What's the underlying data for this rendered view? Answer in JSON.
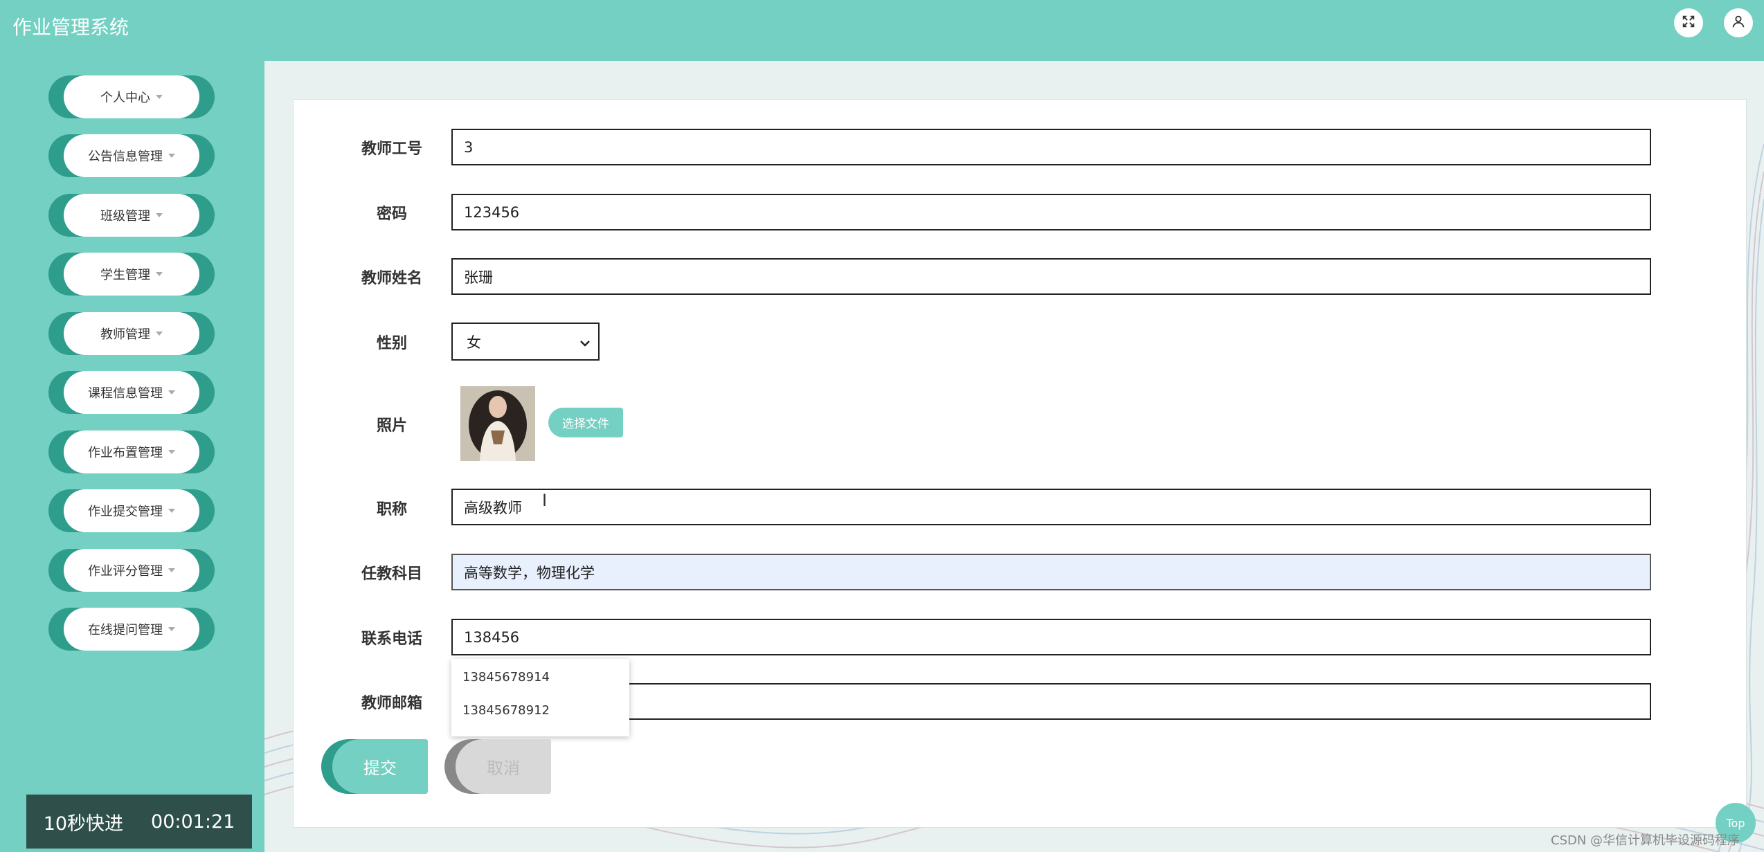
{
  "header": {
    "title": "作业管理系统",
    "fullscreen_icon": "expand-icon",
    "user_icon": "user-icon"
  },
  "sidebar": {
    "items": [
      {
        "label": "个人中心"
      },
      {
        "label": "公告信息管理"
      },
      {
        "label": "班级管理"
      },
      {
        "label": "学生管理"
      },
      {
        "label": "教师管理"
      },
      {
        "label": "课程信息管理"
      },
      {
        "label": "作业布置管理"
      },
      {
        "label": "作业提交管理"
      },
      {
        "label": "作业评分管理"
      },
      {
        "label": "在线提问管理"
      }
    ]
  },
  "overlay_badge": {
    "label": "10秒快进",
    "time": "00:01:21"
  },
  "form": {
    "teacher_id": {
      "label": "教师工号",
      "value": "3"
    },
    "password": {
      "label": "密码",
      "value": "123456"
    },
    "teacher_name": {
      "label": "教师姓名",
      "value": "张珊"
    },
    "gender": {
      "label": "性别",
      "value": "女"
    },
    "photo": {
      "label": "照片",
      "button": "选择文件"
    },
    "title": {
      "label": "职称",
      "value": "高级教师"
    },
    "subjects": {
      "label": "任教科目",
      "value": "高等数学，物理化学"
    },
    "phone": {
      "label": "联系电话",
      "value": "138456"
    },
    "email": {
      "label": "教师邮箱",
      "value": ""
    },
    "autocomplete": [
      "13845678914",
      "13845678912"
    ],
    "submit": "提交",
    "cancel": "取消"
  },
  "top_button": "Top",
  "watermark": "CSDN @华信计算机毕设源码程序",
  "colors": {
    "primary": "#74d0c3",
    "primary_dark": "#2e9d8c",
    "badge_bg": "#2f4f4b",
    "autofill_bg": "#e8f0fe"
  }
}
